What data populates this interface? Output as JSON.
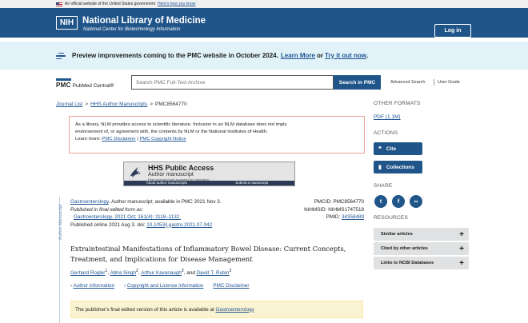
{
  "gov_banner": {
    "text": "An official website of the United States government",
    "how_link": "Here's how you know"
  },
  "header": {
    "logo": "NIH",
    "title": "National Library of Medicine",
    "subtitle": "National Center for Biotechnology Information",
    "login": "Log in"
  },
  "preview_banner": {
    "text": "Preview improvements coming to the PMC website in October 2024.",
    "learn_more": "Learn More",
    "or": "or",
    "try_it": "Try it out now",
    "end": "."
  },
  "search": {
    "logo_pmc": "PMC",
    "logo_central": "PubMed Central®",
    "placeholder": "Search PMC Full-Text Archive",
    "button": "Search in PMC",
    "advanced": "Advanced Search",
    "guide": "User Guide"
  },
  "breadcrumb": {
    "journal_list": "Journal List",
    "hhs": "HHS Author Manuscripts",
    "current": "PMC8564770",
    "sep": ">"
  },
  "disclaimer": {
    "line1": "As a library, NLM provides access to scientific literature. Inclusion in an NLM database does not imply",
    "line2": "endorsement of, or agreement with, the contents by NLM or the National Institutes of Health.",
    "learn_more": "Learn more:",
    "pmc_disclaimer": "PMC Disclaimer",
    "pipe": "|",
    "copyright": "PMC Copyright Notice"
  },
  "hhs_badge": {
    "title": "HHS Public Access",
    "subtitle": "Author manuscript",
    "tagline": "Peer reviewed and accepted for publication",
    "about": "About author manuscripts",
    "submit": "Submit a manuscript"
  },
  "article": {
    "side_label": "Author Manuscript",
    "journal": "Gastroenterology",
    "journal_meta": ". Author manuscript; available in PMC 2021 Nov 3.",
    "published_final": "Published in final edited form as:",
    "final_ref": "Gastroenterology. 2021 Oct; 161(4): 1118–1132.",
    "published_online": "Published online 2021 Aug 3. doi:",
    "doi": "10.1053/j.gastro.2021.07.042",
    "pmcid": "PMCID: PMC8564770",
    "nihmsid": "NIHMSID: NIHMS1747518",
    "pmid_label": "PMID:",
    "pmid": "34358489",
    "title_line1": "Extraintestinal Manifestations of Inflammatory Bowel Disease: Current Concepts,",
    "title_line2": "Treatment, and Implications for Disease Management",
    "authors": [
      {
        "name": "Gerhard Rogler",
        "sup": "1"
      },
      {
        "name": "Abha Singh",
        "sup": "2"
      },
      {
        "name": "Arthur Kavanaugh",
        "sup": "2"
      },
      {
        "name": "David T. Rubin",
        "sup": "3"
      }
    ],
    "and": "and",
    "author_info": "Author information",
    "copyright_info": "Copyright and License information",
    "pmc_disclaimer": "PMC Disclaimer",
    "pub_notice": "The publisher's final edited version of this article is available at",
    "pub_link": "Gastroenterology"
  },
  "sidebar": {
    "other_formats": "OTHER FORMATS",
    "pdf": "PDF (1.1M)",
    "actions": "ACTIONS",
    "cite": "Cite",
    "collections": "Collections",
    "share": "SHARE",
    "resources": "RESOURCES",
    "res_items": [
      "Similar articles",
      "Cited by other articles",
      "Links to NCBI Databases"
    ]
  },
  "colors": {
    "primary": "#20558a",
    "banner_bg": "#e1f3f8",
    "notice_bg": "#faf3d1"
  }
}
